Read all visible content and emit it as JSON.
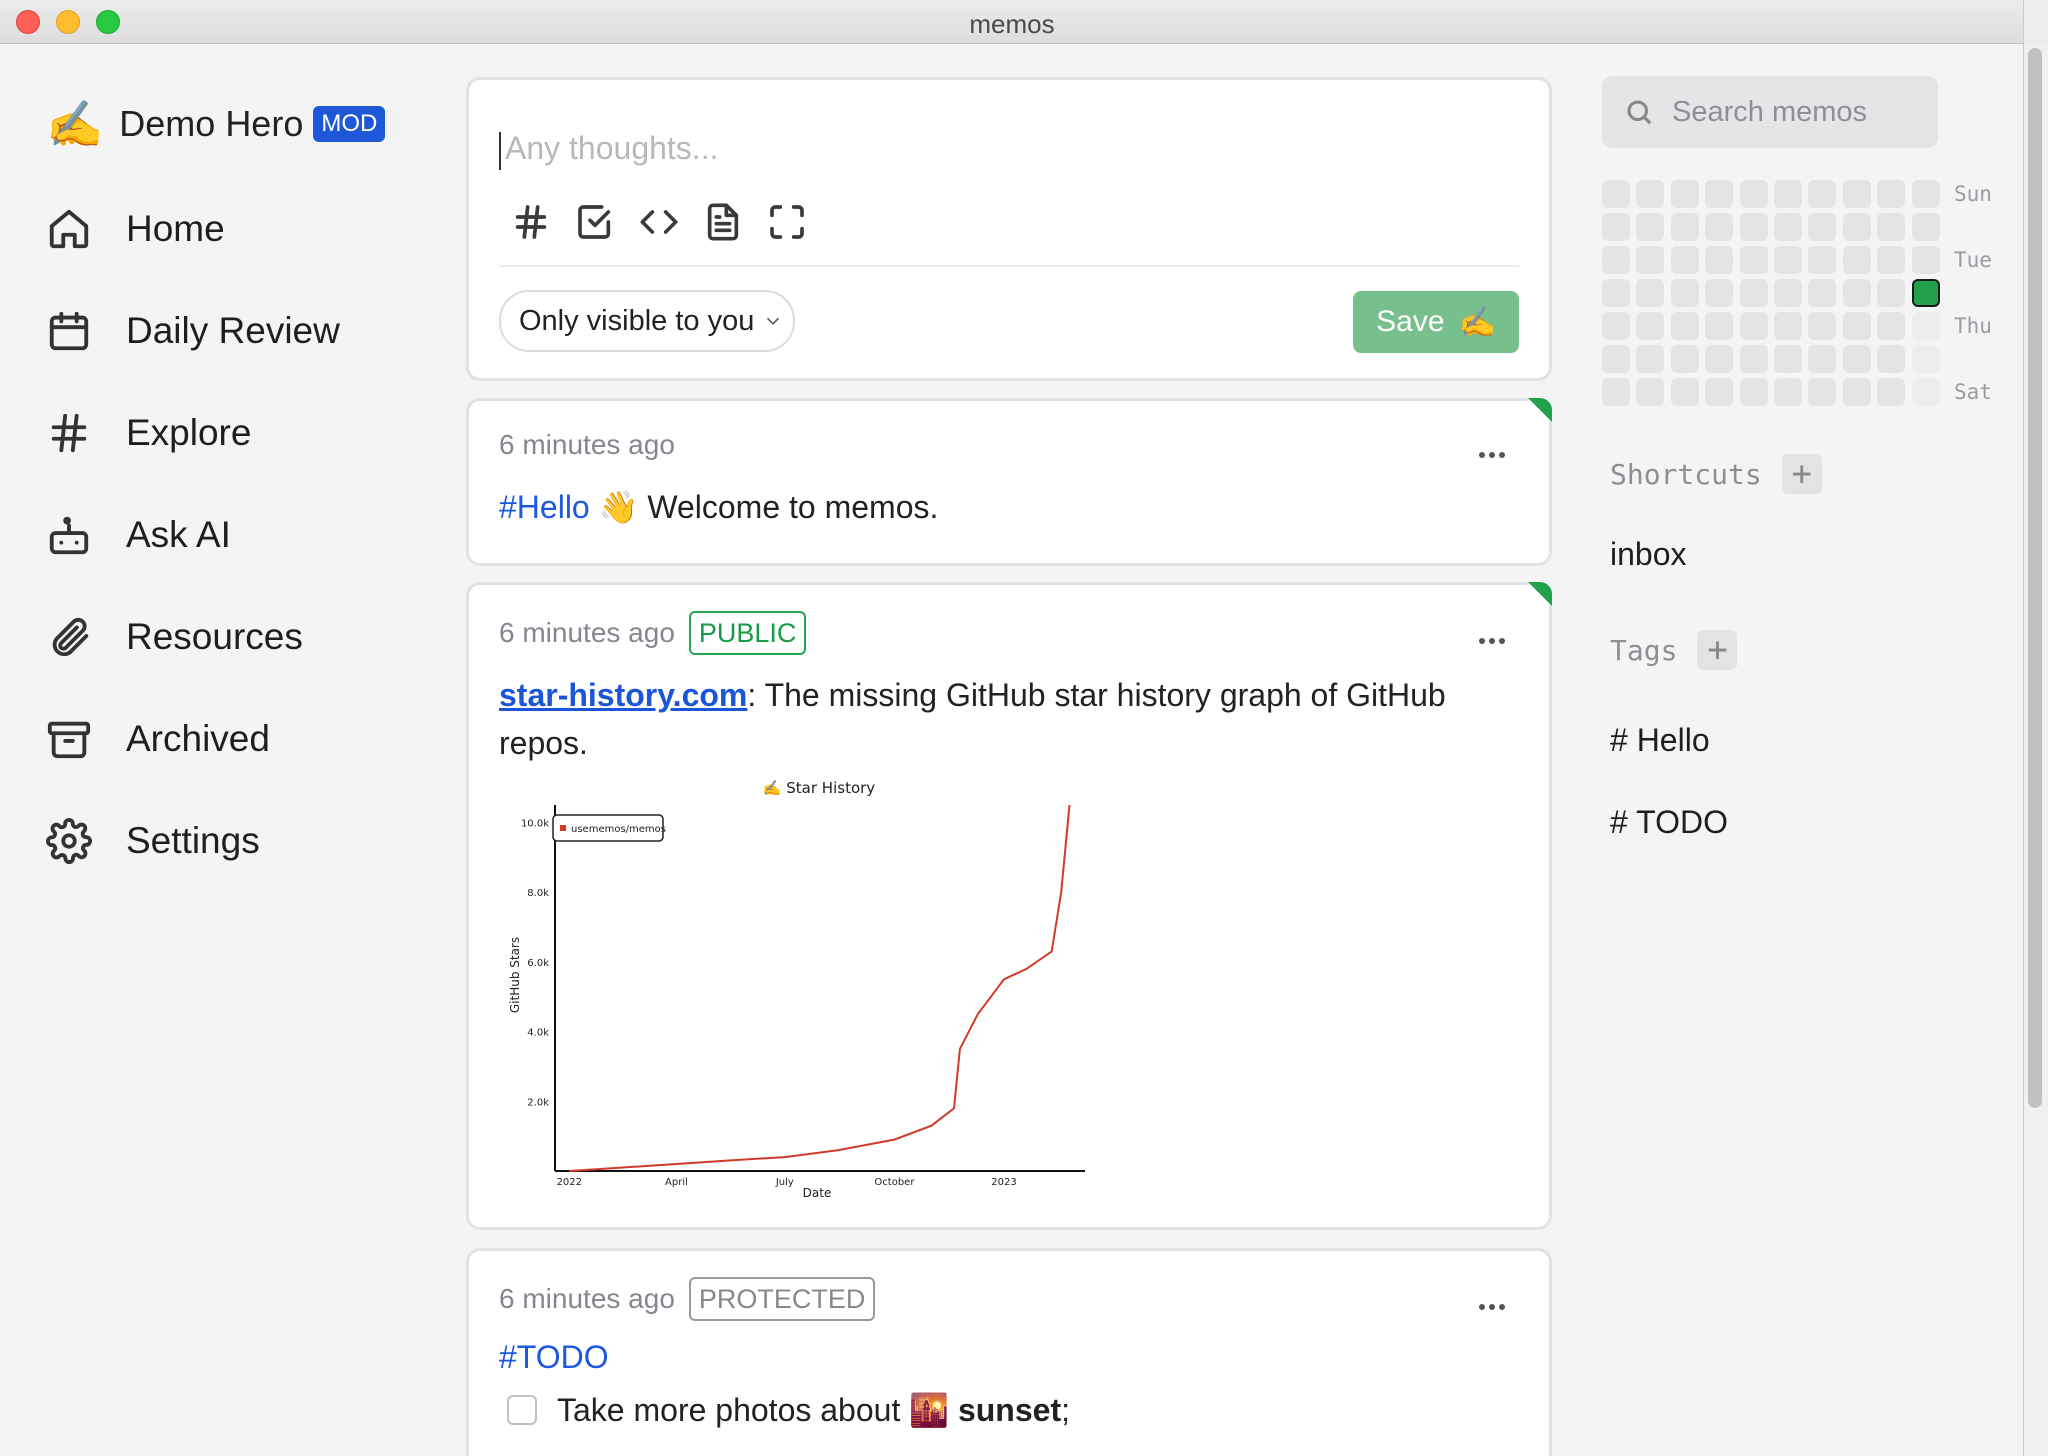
{
  "window": {
    "title": "memos"
  },
  "user": {
    "emoji": "✍️",
    "name": "Demo Hero",
    "role_badge": "MOD"
  },
  "nav": [
    {
      "label": "Home",
      "icon": "home-icon"
    },
    {
      "label": "Daily Review",
      "icon": "calendar-icon"
    },
    {
      "label": "Explore",
      "icon": "hash-icon"
    },
    {
      "label": "Ask AI",
      "icon": "bot-icon"
    },
    {
      "label": "Resources",
      "icon": "paperclip-icon"
    },
    {
      "label": "Archived",
      "icon": "archive-icon"
    },
    {
      "label": "Settings",
      "icon": "gear-icon"
    }
  ],
  "editor": {
    "placeholder": "Any thoughts...",
    "toolbar": [
      "tag-icon",
      "checkbox-icon",
      "code-icon",
      "file-icon",
      "fullscreen-icon"
    ],
    "visibility": "Only visible to you",
    "save_label": "Save",
    "save_emoji": "✍️"
  },
  "memos": [
    {
      "time": "6 minutes ago",
      "tag": "#Hello",
      "emoji": "👋",
      "text": "Welcome to memos."
    },
    {
      "time": "6 minutes ago",
      "badge": "PUBLIC",
      "link": "star-history.com",
      "text_line1": ": The missing GitHub star history graph of GitHub",
      "text_line2": "repos."
    },
    {
      "time": "6 minutes ago",
      "badge": "PROTECTED",
      "tag": "#TODO",
      "todo1_text": "Take more photos about",
      "todo1_emoji": "🌇",
      "todo1_bold": "sunset",
      "todo1_end": ";"
    }
  ],
  "chart_data": {
    "type": "line",
    "title": "✍️ Star History",
    "xlabel": "Date",
    "ylabel": "GitHub Stars",
    "x_ticks": [
      "2022",
      "April",
      "July",
      "October",
      "2023"
    ],
    "y_ticks": [
      "2.0k",
      "4.0k",
      "6.0k",
      "8.0k",
      "10.0k"
    ],
    "ylim": [
      0,
      10500
    ],
    "legend": "top-left",
    "series": [
      {
        "name": "usememos/memos",
        "color": "#d23a2a",
        "points": [
          [
            "2022-01-01",
            0
          ],
          [
            "2022-02-15",
            100
          ],
          [
            "2022-04-01",
            200
          ],
          [
            "2022-05-15",
            300
          ],
          [
            "2022-07-01",
            400
          ],
          [
            "2022-08-15",
            600
          ],
          [
            "2022-10-01",
            900
          ],
          [
            "2022-11-01",
            1300
          ],
          [
            "2022-11-20",
            1800
          ],
          [
            "2022-11-25",
            3500
          ],
          [
            "2022-12-10",
            4500
          ],
          [
            "2023-01-01",
            5500
          ],
          [
            "2023-01-20",
            5800
          ],
          [
            "2023-02-10",
            6300
          ],
          [
            "2023-02-18",
            8000
          ],
          [
            "2023-02-25",
            10500
          ]
        ]
      }
    ]
  },
  "sidebar_right": {
    "search_placeholder": "Search memos",
    "day_labels": [
      "Sun",
      "Tue",
      "Thu",
      "Sat"
    ],
    "shortcuts_title": "Shortcuts",
    "shortcuts": [
      "inbox"
    ],
    "tags_title": "Tags",
    "tags": [
      "# Hello",
      "# TODO"
    ]
  },
  "colors": {
    "accent": "#1d58d8",
    "save": "#77c08e",
    "public": "#25a552",
    "heat_active": "#22a04a"
  }
}
